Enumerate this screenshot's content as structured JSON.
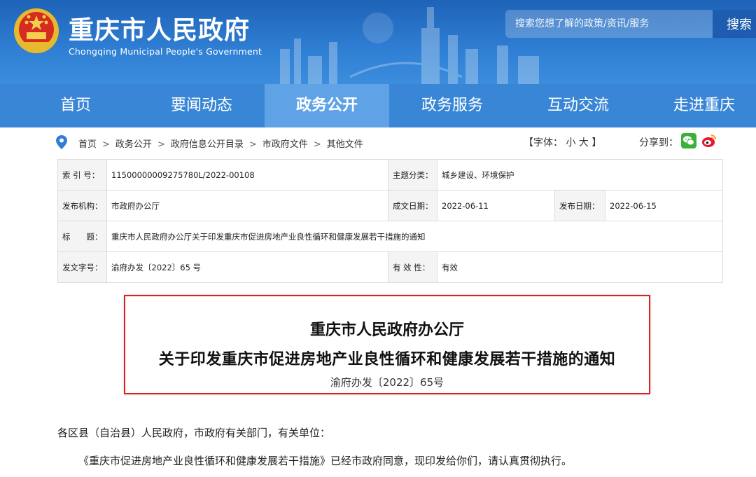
{
  "header": {
    "title": "重庆市人民政府",
    "subtitle": "Chongqing Municipal People's Government",
    "search_placeholder": "搜索您想了解的政策/资讯/服务",
    "search_button": "搜索"
  },
  "nav": {
    "items": [
      {
        "label": "首页"
      },
      {
        "label": "要闻动态"
      },
      {
        "label": "政务公开"
      },
      {
        "label": "政务服务"
      },
      {
        "label": "互动交流"
      },
      {
        "label": "走进重庆"
      }
    ],
    "active": "政务公开"
  },
  "breadcrumb": [
    "首页",
    "政务公开",
    "政府信息公开目录",
    "市政府文件",
    "其他文件"
  ],
  "breadcrumb_sep": ">",
  "font_size": {
    "label": "【字体：",
    "small": "小",
    "large": "大",
    "close": "】"
  },
  "share": {
    "label": "分享到："
  },
  "meta": {
    "index_label": "索 引 号：",
    "index_value": "11500000009275780L/2022-00108",
    "category_label": "主题分类：",
    "category_value": "城乡建设、环境保护",
    "org_label": "发布机构：",
    "org_value": "市政府办公厅",
    "written_label": "成文日期：",
    "written_value": "2022-06-11",
    "published_label": "发布日期：",
    "published_value": "2022-06-15",
    "title_label": "标　　题：",
    "title_value": "重庆市人民政府办公厅关于印发重庆市促进房地产业良性循环和健康发展若干措施的通知",
    "docno_label": "发文字号：",
    "docno_value": "渝府办发〔2022〕65 号",
    "validity_label": "有 效 性：",
    "validity_value": "有效"
  },
  "document": {
    "issuer": "重庆市人民政府办公厅",
    "title": "关于印发重庆市促进房地产业良性循环和健康发展若干措施的通知",
    "number": "渝府办发〔2022〕65号"
  },
  "body": {
    "salutation": "各区县（自治县）人民政府，市政府有关部门，有关单位：",
    "paragraph1": "《重庆市促进房地产业良性循环和健康发展若干措施》已经市政府同意，现印发给你们，请认真贯彻执行。"
  },
  "colors": {
    "header_blue": "#2f7fd4",
    "nav_blue": "#3a86d6",
    "nav_active": "#5fa3e6",
    "highlight_red": "#e02020"
  }
}
